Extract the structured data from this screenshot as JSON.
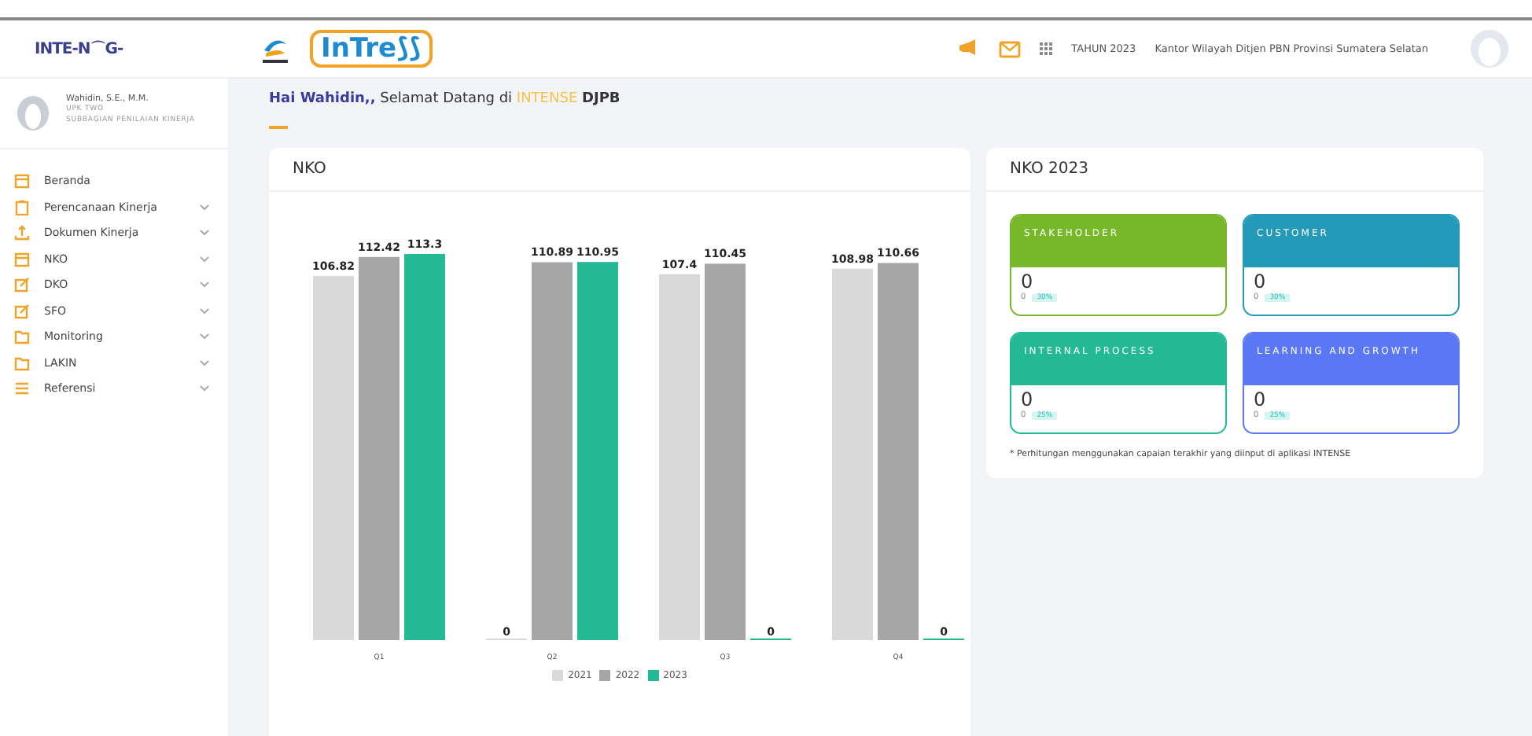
{
  "brand": {
    "left_logo": "INTE-N⌒G-",
    "app_logo": "InTre⟆⟆"
  },
  "header": {
    "year": "TAHUN 2023",
    "office": "Kantor Wilayah Ditjen PBN Provinsi Sumatera Selatan"
  },
  "user": {
    "name": "Wahidin, S.E., M.M.",
    "unit": "UPK TWO",
    "role": "SUBBAGIAN PENILAIAN KINERJA"
  },
  "sidebar": {
    "items": [
      {
        "label": "Beranda",
        "kind": "calendar",
        "expandable": false
      },
      {
        "label": "Perencanaan Kinerja",
        "kind": "clipboard",
        "expandable": true
      },
      {
        "label": "Dokumen Kinerja",
        "kind": "upload",
        "expandable": true
      },
      {
        "label": "NKO",
        "kind": "calendar",
        "expandable": true
      },
      {
        "label": "DKO",
        "kind": "edit",
        "expandable": true
      },
      {
        "label": "SFO",
        "kind": "edit",
        "expandable": true
      },
      {
        "label": "Monitoring",
        "kind": "folder",
        "expandable": true
      },
      {
        "label": "LAKIN",
        "kind": "folder",
        "expandable": true
      },
      {
        "label": "Referensi",
        "kind": "list",
        "expandable": true
      }
    ]
  },
  "greeting": {
    "hello": "Hai Wahidin,,",
    "text": "Selamat Datang di",
    "app": "INTENSE",
    "org": "DJPB"
  },
  "nko_panel": {
    "title": "NKO",
    "chart_data": {
      "type": "bar",
      "categories": [
        "Q1",
        "Q2",
        "Q3",
        "Q4"
      ],
      "data_labels": true,
      "series": [
        {
          "name": "2021",
          "color": "#d9d9d9",
          "values": [
            106.82,
            0,
            107.4,
            108.98
          ]
        },
        {
          "name": "2022",
          "color": "#a6a6a6",
          "values": [
            112.42,
            110.89,
            110.45,
            110.66
          ]
        },
        {
          "name": "2023",
          "color": "#22b994",
          "values": [
            113.3,
            110.95,
            0,
            0
          ]
        }
      ]
    }
  },
  "nko_2023": {
    "title": "NKO 2023",
    "cards": [
      {
        "title": "STAKEHOLDER",
        "color": "#76b82a",
        "value": "0",
        "sub": "0",
        "badge": "30%"
      },
      {
        "title": "CUSTOMER",
        "color": "#2499b8",
        "value": "0",
        "sub": "0",
        "badge": "30%"
      },
      {
        "title": "INTERNAL PROCESS",
        "color": "#22b994",
        "value": "0",
        "sub": "0",
        "badge": "25%"
      },
      {
        "title": "LEARNING AND GROWTH",
        "color": "#5a77f5",
        "value": "0",
        "sub": "0",
        "badge": "25%"
      }
    ],
    "note": "* Perhitungan menggunakan capaian terakhir yang diinput di aplikasi INTENSE"
  }
}
